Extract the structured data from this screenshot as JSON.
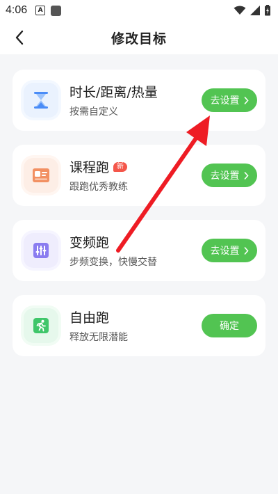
{
  "status_bar": {
    "time": "4:06",
    "a_icon_text": "A"
  },
  "header": {
    "title": "修改目标"
  },
  "cards": [
    {
      "title": "时长/距离/热量",
      "subtitle": "按需自定义",
      "button_label": "去设置",
      "icon": "hourglass-icon",
      "icon_color": "#4a8cf7"
    },
    {
      "title": "课程跑",
      "badge": "新",
      "subtitle": "跟跑优秀教练",
      "button_label": "去设置",
      "icon": "course-card-icon",
      "icon_color": "#f29062"
    },
    {
      "title": "变频跑",
      "subtitle": "步频变换，快慢交替",
      "button_label": "去设置",
      "icon": "sliders-icon",
      "icon_color": "#8a7cf0"
    },
    {
      "title": "自由跑",
      "subtitle": "释放无限潜能",
      "button_label": "确定",
      "icon": "runner-icon",
      "icon_color": "#3fc66a"
    }
  ],
  "colors": {
    "accent_green": "#52c452",
    "background": "#f5f6f8",
    "annotation_arrow": "#ee1c24"
  }
}
